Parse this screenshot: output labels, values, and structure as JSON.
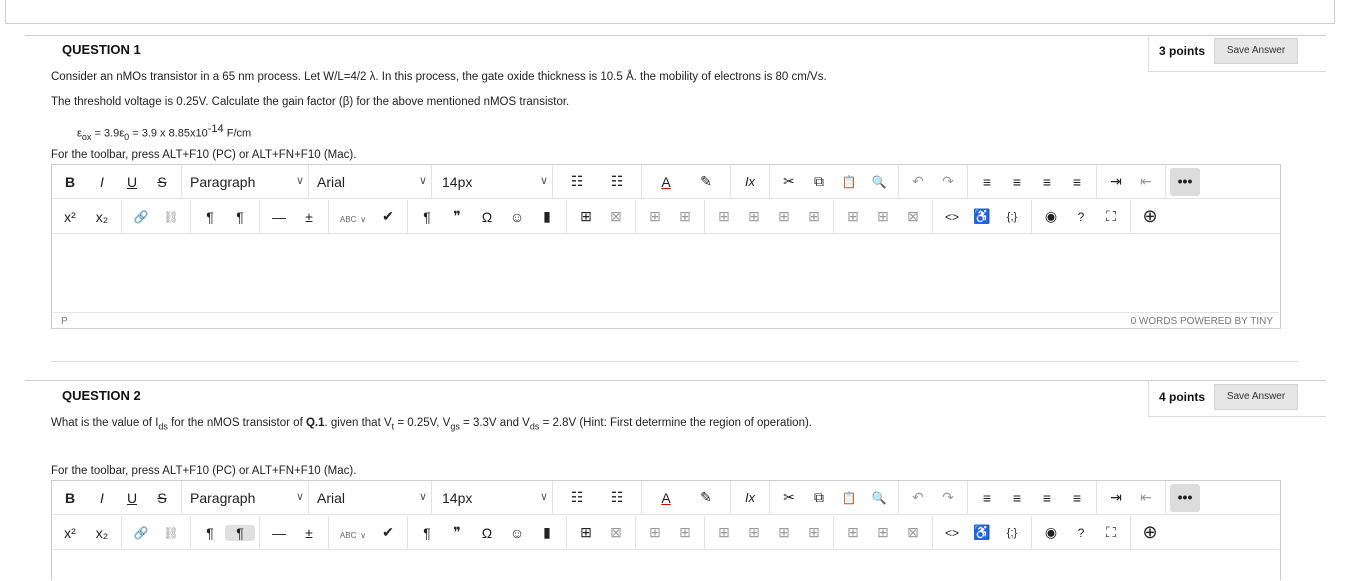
{
  "q1": {
    "heading": "QUESTION 1",
    "points": "3 points",
    "save": "Save Answer",
    "text1": "Consider an nMOs transistor in a 65 nm process. Let W/L=4/2 λ. In this process, the gate oxide thickness is 10.5 Å. the mobility of electrons is 80 cm/Vs.",
    "text2": "The threshold voltage is 0.25V.  Calculate the gain factor (β) for the above mentioned nMOS transistor.",
    "formula_a": "ε",
    "formula_a_sub": "ox",
    "formula_b": " = 3.9ε",
    "formula_b_sub": "0",
    "formula_c": " = 3.9 x 8.85x10",
    "formula_c_sup": "-14",
    "formula_d": " F/cm",
    "hint": "For the toolbar, press ALT+F10 (PC) or ALT+FN+F10 (Mac).",
    "status_path": "P",
    "status_right": "0 WORDS  POWERED BY TINY"
  },
  "q2": {
    "heading": "QUESTION 2",
    "points": "4 points",
    "save": "Save Answer",
    "t1": "What is the value of I",
    "t1_sub": "ds",
    "t2": " for the nMOS transistor of ",
    "t2_bold": "Q.1",
    "t3": ". given that V",
    "t3_sub": "t",
    "t4": " = 0.25V, V",
    "t4_sub": "gs",
    "t5": " = 3.3V and V",
    "t5_sub": "ds",
    "t6": " = 2.8V (Hint: First determine the region of operation).",
    "hint": "For the toolbar, press ALT+F10 (PC) or ALT+FN+F10 (Mac)."
  },
  "toolbar": {
    "bold": "B",
    "italic": "I",
    "underline": "U",
    "strike": "S",
    "block": "Paragraph",
    "font": "Arial",
    "size": "14px",
    "caret": "∨",
    "ul": "☷",
    "ol": "☷",
    "fontcolor": "A",
    "highlight": "✎",
    "clear": "Ix",
    "cut": "✂",
    "copy": "⧉",
    "paste": "📋",
    "find": "🔍",
    "undo": "↶",
    "redo": "↷",
    "al": "≡",
    "ac": "≡",
    "ar": "≡",
    "aj": "≡",
    "indent": "⇥",
    "outdent": "⇤",
    "more": "•••",
    "sup": "x²",
    "sub": "x₂",
    "link": "🔗",
    "unlink": "⛓",
    "ltr": "¶",
    "rtl": "¶",
    "hr": "—",
    "plusminus": "±",
    "spell": "ABC",
    "check": "✔",
    "pilcrow": "¶",
    "quote": "❞",
    "omega": "Ω",
    "emoji": "☺",
    "anchor": "▮",
    "table": "⊞",
    "tdel": "⊠",
    "tc1": "⊞",
    "tc2": "⊞",
    "tc3": "⊞",
    "tc4": "⊞",
    "tc5": "⊞",
    "tc6": "⊞",
    "tc7": "⊞",
    "tc8": "⊞",
    "tc9": "⊠",
    "code": "<>",
    "access": "♿",
    "braces": "{;}",
    "preview": "◉",
    "help": "?",
    "fullscreen": "⛶",
    "add": "⊕"
  }
}
